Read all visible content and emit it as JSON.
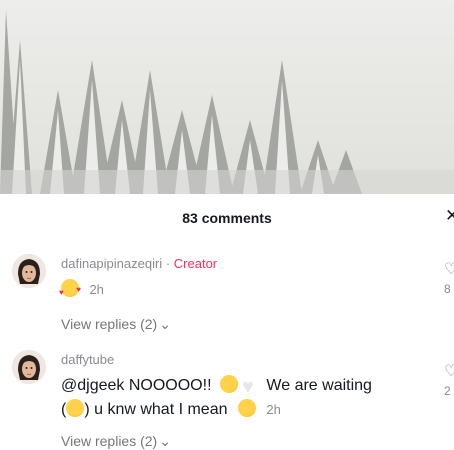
{
  "comments_sheet": {
    "title": "83 comments",
    "close_icon": "close-icon"
  },
  "comments": [
    {
      "username": "dafinapipinazeqiri",
      "separator": "·",
      "badge": "Creator",
      "text": "",
      "time": "2h",
      "emoji": "smiling-face-with-hearts",
      "view_replies": "View replies (2)",
      "like_count": "8"
    },
    {
      "username": "daffytube",
      "text_line1_pre": "@djgeek NOOOOO!!",
      "text_line1_post": "We are waiting",
      "text_line2_pre": "(",
      "text_line2_post": ") u knw what I mean",
      "time": "2h",
      "emojis": [
        "rolling-on-floor-laughing",
        "white-heart",
        "baby-chick",
        "smirking-face"
      ],
      "view_replies": "View replies (2)",
      "like_count": "2"
    }
  ],
  "colors": {
    "creator_badge": "#fe2c55",
    "secondary_text": "#8a8b91"
  }
}
